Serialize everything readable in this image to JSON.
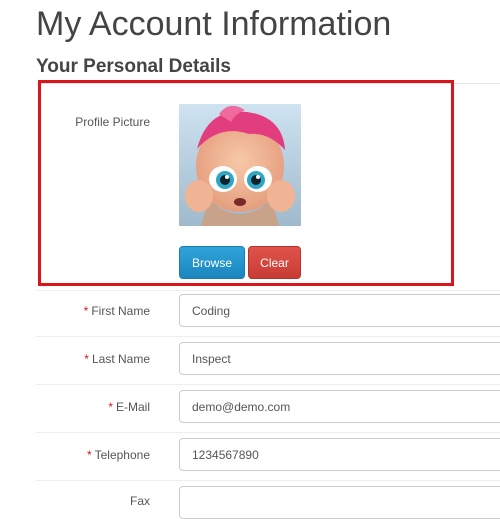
{
  "page": {
    "title": "My Account Information",
    "section_title": "Your Personal Details"
  },
  "profile": {
    "label": "Profile Picture",
    "browse_label": "Browse",
    "clear_label": "Clear"
  },
  "fields": [
    {
      "label": "First Name",
      "value": "Coding",
      "required": true
    },
    {
      "label": "Last Name",
      "value": "Inspect",
      "required": true
    },
    {
      "label": "E-Mail",
      "value": "demo@demo.com",
      "required": true
    },
    {
      "label": "Telephone",
      "value": "1234567890",
      "required": true
    },
    {
      "label": "Fax",
      "value": "",
      "required": false
    }
  ],
  "colors": {
    "required": "#d9161c",
    "browse": "#1b86bd",
    "clear": "#c73c33",
    "highlight": "#d9161c"
  }
}
